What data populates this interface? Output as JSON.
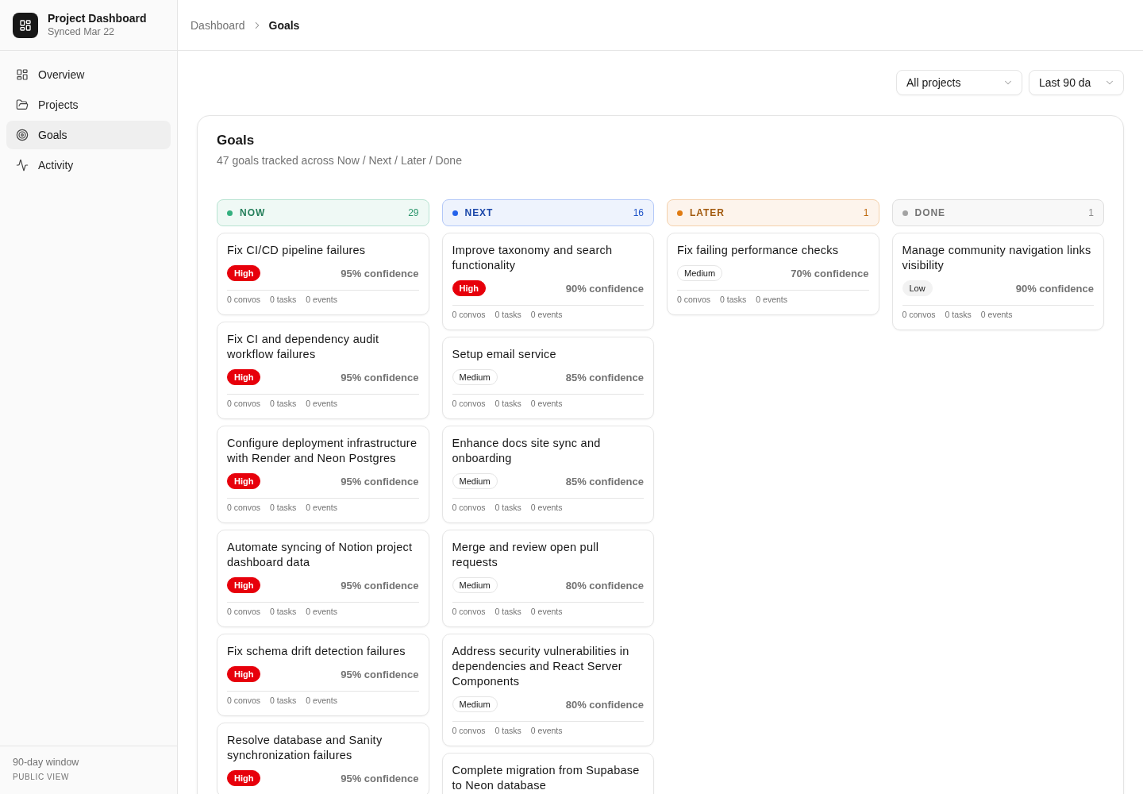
{
  "sidebar": {
    "title": "Project Dashboard",
    "subtitle": "Synced Mar 22",
    "items": [
      {
        "label": "Overview",
        "selected": false
      },
      {
        "label": "Projects",
        "selected": false
      },
      {
        "label": "Goals",
        "selected": true
      },
      {
        "label": "Activity",
        "selected": false
      }
    ],
    "footer": {
      "window": "90-day window",
      "view": "PUBLIC VIEW"
    }
  },
  "breadcrumb": [
    {
      "label": "Dashboard",
      "current": false
    },
    {
      "label": "Goals",
      "current": true
    }
  ],
  "filters": [
    {
      "value": "All projects"
    },
    {
      "value": "Last 90 da"
    }
  ],
  "panel": {
    "title": "Goals",
    "subtitle": "47 goals tracked across Now / Next / Later / Done"
  },
  "columns": [
    {
      "label": "NOW",
      "count": "29",
      "color": "#34b07f",
      "cards": [
        {
          "title": "Fix CI/CD pipeline failures",
          "kind": "high",
          "priority": "High",
          "confidence": "95% confidence",
          "stats": [
            "0 convos",
            "0 tasks",
            "0 events"
          ]
        },
        {
          "title": "Fix CI and dependency audit workflow failures",
          "kind": "high",
          "priority": "High",
          "confidence": "95% confidence",
          "stats": [
            "0 convos",
            "0 tasks",
            "0 events"
          ]
        },
        {
          "title": "Configure deployment infrastructure with Render and Neon Postgres",
          "kind": "high",
          "priority": "High",
          "confidence": "95% confidence",
          "stats": [
            "0 convos",
            "0 tasks",
            "0 events"
          ]
        },
        {
          "title": "Automate syncing of Notion project dashboard data",
          "kind": "high",
          "priority": "High",
          "confidence": "95% confidence",
          "stats": [
            "0 convos",
            "0 tasks",
            "0 events"
          ]
        },
        {
          "title": "Fix schema drift detection failures",
          "kind": "high",
          "priority": "High",
          "confidence": "95% confidence",
          "stats": [
            "0 convos",
            "0 tasks",
            "0 events"
          ]
        },
        {
          "title": "Resolve database and Sanity synchronization failures",
          "kind": "high",
          "priority": "High",
          "confidence": "95% confidence"
        }
      ]
    },
    {
      "label": "NEXT",
      "count": "16",
      "color": "#2563eb",
      "cards": [
        {
          "title": "Improve taxonomy and search functionality",
          "kind": "high",
          "priority": "High",
          "confidence": "90% confidence",
          "stats": [
            "0 convos",
            "0 tasks",
            "0 events"
          ]
        },
        {
          "title": "Setup email service",
          "kind": "medium",
          "priority": "Medium",
          "confidence": "85% confidence",
          "stats": [
            "0 convos",
            "0 tasks",
            "0 events"
          ]
        },
        {
          "title": "Enhance docs site sync and onboarding",
          "kind": "medium",
          "priority": "Medium",
          "confidence": "85% confidence",
          "stats": [
            "0 convos",
            "0 tasks",
            "0 events"
          ]
        },
        {
          "title": "Merge and review open pull requests",
          "kind": "medium",
          "priority": "Medium",
          "confidence": "80% confidence",
          "stats": [
            "0 convos",
            "0 tasks",
            "0 events"
          ]
        },
        {
          "title": "Address security vulnerabilities in dependencies and React Server Components",
          "kind": "medium",
          "priority": "Medium",
          "confidence": "80% confidence",
          "stats": [
            "0 convos",
            "0 tasks",
            "0 events"
          ]
        },
        {
          "title": "Complete migration from Supabase to Neon database"
        }
      ]
    },
    {
      "label": "LATER",
      "count": "1",
      "color": "#e07b12",
      "cards": [
        {
          "title": "Fix failing performance checks",
          "kind": "medium",
          "priority": "Medium",
          "confidence": "70% confidence",
          "stats": [
            "0 convos",
            "0 tasks",
            "0 events"
          ]
        }
      ]
    },
    {
      "label": "DONE",
      "count": "1",
      "color": "#a3a3a3",
      "cards": [
        {
          "title": "Manage community navigation links visibility",
          "kind": "low",
          "priority": "Low",
          "confidence": "90% confidence",
          "stats": [
            "0 convos",
            "0 tasks",
            "0 events"
          ]
        }
      ]
    }
  ]
}
